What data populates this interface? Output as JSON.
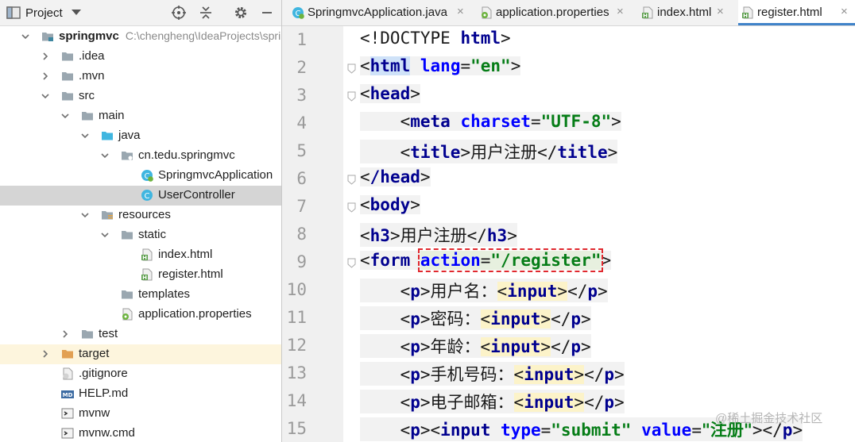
{
  "project_panel": {
    "title": "Project",
    "tree": [
      {
        "label": "springmvc",
        "path": "C:\\chengheng\\IdeaProjects\\springmvc",
        "icon": "module-folder-icon",
        "depth": 0,
        "expanded": true,
        "bold": true
      },
      {
        "label": ".idea",
        "icon": "folder-icon",
        "depth": 1,
        "expanded": false
      },
      {
        "label": ".mvn",
        "icon": "folder-icon",
        "depth": 1,
        "expanded": false
      },
      {
        "label": "src",
        "icon": "folder-icon",
        "depth": 1,
        "expanded": true
      },
      {
        "label": "main",
        "icon": "folder-icon",
        "depth": 2,
        "expanded": true
      },
      {
        "label": "java",
        "icon": "source-folder-icon",
        "depth": 3,
        "expanded": true
      },
      {
        "label": "cn.tedu.springmvc",
        "icon": "package-icon",
        "depth": 4,
        "expanded": true
      },
      {
        "label": "SpringmvcApplication",
        "icon": "spring-boot-class-icon",
        "depth": 5
      },
      {
        "label": "UserController",
        "icon": "class-icon",
        "depth": 5,
        "selected": true
      },
      {
        "label": "resources",
        "icon": "resources-folder-icon",
        "depth": 3,
        "expanded": true
      },
      {
        "label": "static",
        "icon": "folder-icon",
        "depth": 4,
        "expanded": true
      },
      {
        "label": "index.html",
        "icon": "html-file-icon",
        "depth": 5
      },
      {
        "label": "register.html",
        "icon": "html-file-icon",
        "depth": 5
      },
      {
        "label": "templates",
        "icon": "folder-icon",
        "depth": 4
      },
      {
        "label": "application.properties",
        "icon": "properties-file-icon",
        "depth": 4
      },
      {
        "label": "test",
        "icon": "folder-icon",
        "depth": 2,
        "expanded": false
      },
      {
        "label": "target",
        "icon": "excluded-folder-icon",
        "depth": 1,
        "expanded": false,
        "excluded": true
      },
      {
        "label": ".gitignore",
        "icon": "gitignore-file-icon",
        "depth": 1
      },
      {
        "label": "HELP.md",
        "icon": "markdown-file-icon",
        "depth": 1
      },
      {
        "label": "mvnw",
        "icon": "script-file-icon",
        "depth": 1
      },
      {
        "label": "mvnw.cmd",
        "icon": "script-file-icon",
        "depth": 1
      }
    ]
  },
  "tabs": [
    {
      "label": "SpringmvcApplication.java",
      "icon": "spring-boot-class-icon",
      "active": false
    },
    {
      "label": "application.properties",
      "icon": "properties-file-icon",
      "active": false
    },
    {
      "label": "index.html",
      "icon": "html-file-icon",
      "active": false
    },
    {
      "label": "register.html",
      "icon": "html-file-icon",
      "active": true
    }
  ],
  "tab_close_glyph": "×",
  "editor": {
    "line_numbers": [
      "1",
      "2",
      "3",
      "4",
      "5",
      "6",
      "7",
      "8",
      "9",
      "10",
      "11",
      "12",
      "13",
      "14",
      "15"
    ],
    "code": {
      "l1_doctype": "<!DOCTYPE ",
      "l1_html": "html",
      "l1_end": ">",
      "html_tag": "html",
      "lang_attr": "lang",
      "lang_val": "\"en\"",
      "head_open": "head",
      "meta_tag": "meta",
      "charset_attr": "charset",
      "charset_val": "\"UTF-8\"",
      "title_tag": "title",
      "title_text": "用户注册",
      "head_close": "/head",
      "body_tag": "body",
      "h3_tag": "h3",
      "h3_text": "用户注册",
      "form_tag": "form",
      "action_attr": "action",
      "action_val": "\"/register\"",
      "p_tag": "p",
      "input_tag": "input",
      "label_username": "用户名：",
      "label_password": "密码：",
      "label_age": "年龄：",
      "label_phone": "手机号码：",
      "label_email": "电子邮箱：",
      "type_attr": "type",
      "type_val": "\"submit\"",
      "value_attr": "value",
      "value_val": "\"注册\""
    }
  },
  "watermark": "@稀土掘金技术社区",
  "colors": {
    "tag": "#00008f",
    "attr": "#0000ff",
    "string": "#067d17",
    "selection": "#d5d5d5",
    "excluded_bg": "#fdf5dd",
    "highlight_box": "#e0282e",
    "active_tab": "#4083c9"
  }
}
